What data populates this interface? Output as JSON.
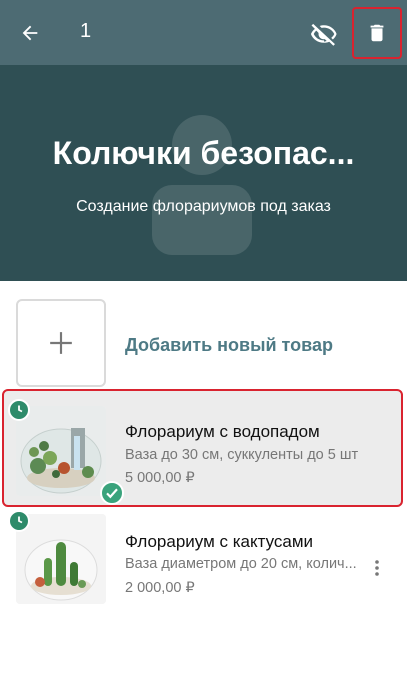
{
  "toolbar": {
    "selected_count": "1",
    "icons": {
      "back": "arrow-left-icon",
      "hide": "eye-off-icon",
      "delete": "trash-icon"
    }
  },
  "banner": {
    "title": "Колючки безопас...",
    "subtitle": "Создание флорариумов под заказ"
  },
  "add_item": {
    "label": "Добавить новый товар"
  },
  "products": [
    {
      "title": "Флорариум с водопадом",
      "description": "Ваза до 30 см, суккуленты до 5 шт",
      "price": "5 000,00 ₽",
      "selected": true
    },
    {
      "title": "Флорариум с кактусами",
      "description": "Ваза диаметром до 20 см, колич...",
      "price": "2 000,00 ₽",
      "selected": false
    }
  ],
  "colors": {
    "toolbar": "#4d6b73",
    "banner": "#2f4f54",
    "accent": "#4e7a85",
    "highlight": "#d9232f",
    "status_green": "#2e8b6a"
  }
}
